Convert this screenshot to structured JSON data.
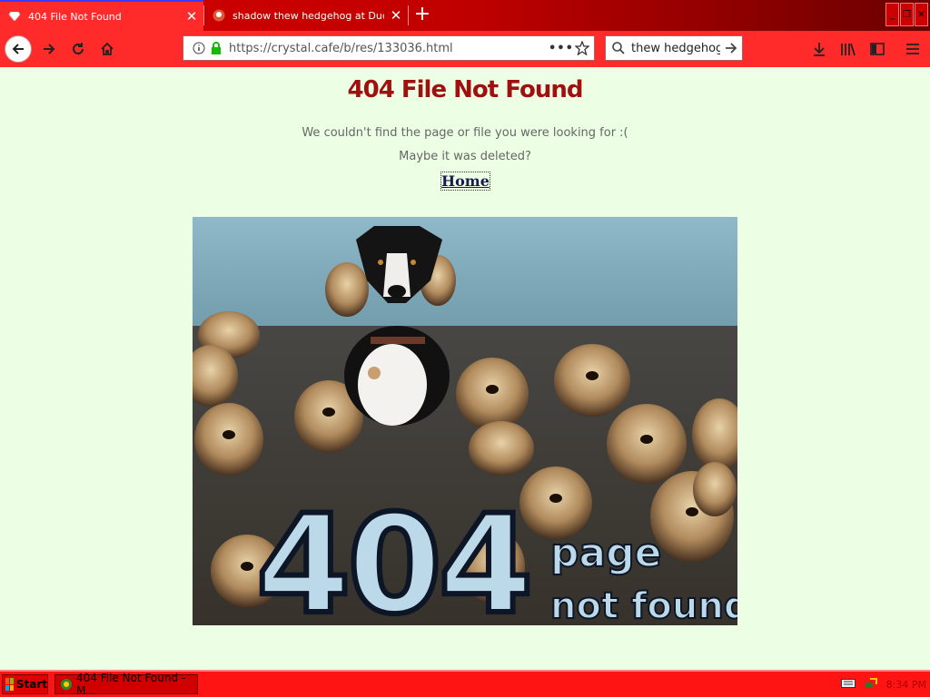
{
  "browser": {
    "tabs": [
      {
        "title": "404 File Not Found",
        "active": true
      },
      {
        "title": "shadow thew hedgehog at DuckDuckGo",
        "active": false
      }
    ],
    "address": {
      "url": "https://crystal.cafe/b/res/133036.html"
    },
    "search": {
      "value": "thew hedgehog"
    }
  },
  "page": {
    "heading": "404 File Not Found",
    "message_line1": "We couldn't find the page or file you were looking for :(",
    "message_line2": "Maybe it was deleted?",
    "home_link": "Home",
    "image": {
      "text_404": "404",
      "text_page": "page",
      "text_not_found": "not found"
    }
  },
  "taskbar": {
    "start_label": "Start",
    "task_label": "404 File Not Found - M...",
    "clock": "8:34 PM"
  },
  "colors": {
    "chrome_red": "#ff2a2a",
    "page_bg": "#ecffe4",
    "heading": "#a01010"
  }
}
